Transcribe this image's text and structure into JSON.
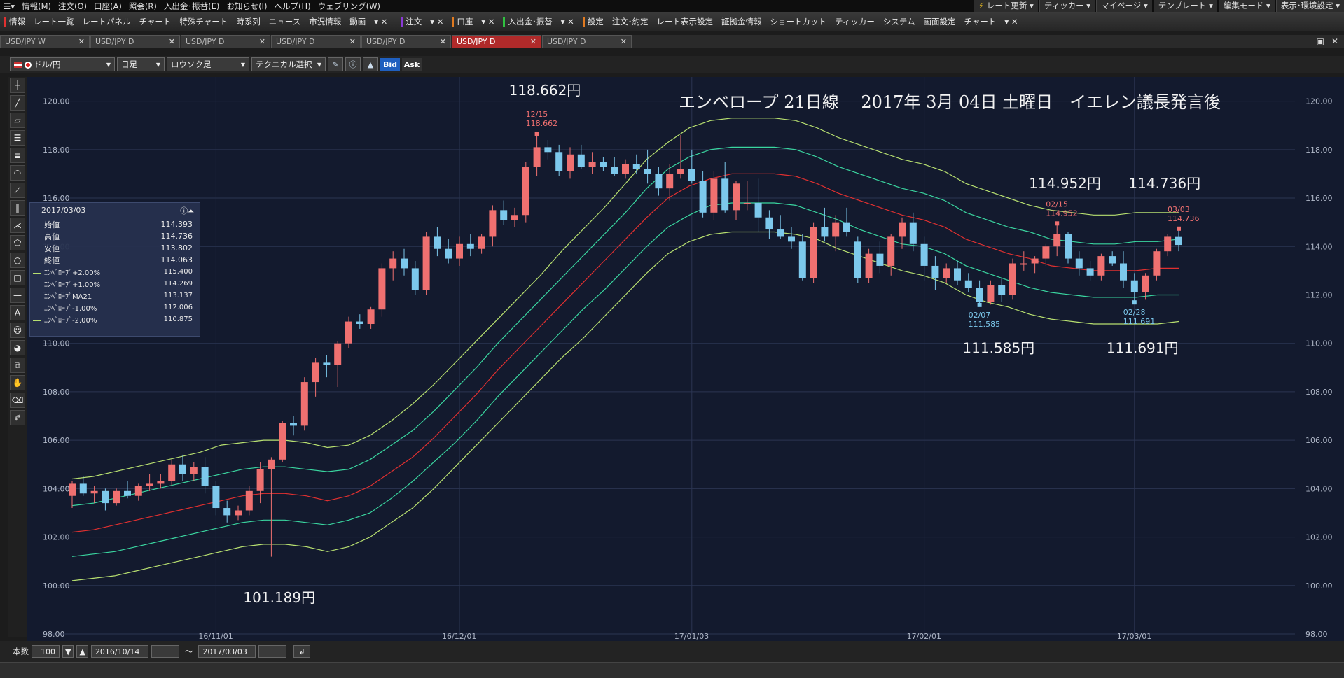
{
  "menubar": {
    "items": [
      "情報(M)",
      "注文(O)",
      "口座(A)",
      "照会(R)",
      "入出金･振替(E)",
      "お知らせ(I)",
      "ヘルプ(H)",
      "ウェブリング(W)"
    ],
    "right_buttons": [
      "レート更新",
      "ティッカー",
      "マイページ",
      "テンプレート",
      "編集モード",
      "表示･環境設定"
    ]
  },
  "toolbar": {
    "items": [
      "情報",
      "レート一覧",
      "レートパネル",
      "チャート",
      "特殊チャート",
      "時系列",
      "ニュース",
      "市況情報",
      "動画"
    ],
    "buttons": [
      "注文",
      "口座",
      "入出金･振替",
      "設定"
    ],
    "items2": [
      "注文･約定",
      "レート表示設定",
      "証拠金情報",
      "ショートカット",
      "ティッカー",
      "システム",
      "画面設定",
      "チャート"
    ],
    "accent_colors": [
      "#e03030",
      "#8a3ad6",
      "#e07a20",
      "#30c040",
      "#e07a20"
    ]
  },
  "tabs": [
    "USD/JPY W",
    "USD/JPY D",
    "USD/JPY D",
    "USD/JPY D",
    "USD/JPY D",
    "USD/JPY D",
    "USD/JPY D"
  ],
  "active_tab": 5,
  "controls": {
    "pair": "ドル/円",
    "timeframe": "日足",
    "chart_type": "ロウソク足",
    "technical": "テクニカル選択",
    "bid": "Bid",
    "ask": "Ask"
  },
  "infobox": {
    "date": "2017/03/03",
    "rows": [
      {
        "label": "始値",
        "value": "114.393"
      },
      {
        "label": "高値",
        "value": "114.736"
      },
      {
        "label": "安値",
        "value": "113.802"
      },
      {
        "label": "終値",
        "value": "114.063"
      }
    ],
    "indicators": [
      {
        "label": "ｴﾝﾍﾞﾛｰﾌﾟ+2.00%",
        "value": "115.400",
        "color": "#b8e070"
      },
      {
        "label": "ｴﾝﾍﾞﾛｰﾌﾟ+1.00%",
        "value": "114.269",
        "color": "#3ad6a0"
      },
      {
        "label": "ｴﾝﾍﾞﾛｰﾌﾟMA21",
        "value": "113.137",
        "color": "#e03030"
      },
      {
        "label": "ｴﾝﾍﾞﾛｰﾌﾟ-1.00%",
        "value": "112.006",
        "color": "#3ad6a0"
      },
      {
        "label": "ｴﾝﾍﾞﾛｰﾌﾟ-2.00%",
        "value": "110.875",
        "color": "#b8e070"
      }
    ]
  },
  "footer": {
    "count_label": "本数",
    "count": "100",
    "from": "2016/10/14",
    "tilde": "～",
    "to": "2017/03/03"
  },
  "chart_data": {
    "type": "candlestick",
    "title": "エンベロープ 21日線　 2017年 3月 04日 土曜日　イエレン議長発言後",
    "ylim": [
      98,
      121
    ],
    "yticks": [
      "98.00",
      "100.00",
      "102.00",
      "104.00",
      "106.00",
      "108.00",
      "110.00",
      "112.00",
      "114.00",
      "116.00",
      "118.00",
      "120.00"
    ],
    "xticks": [
      {
        "label": "16/11/01",
        "index": 13
      },
      {
        "label": "16/12/01",
        "index": 35
      },
      {
        "label": "17/01/03",
        "index": 56
      },
      {
        "label": "17/02/01",
        "index": 77
      },
      {
        "label": "17/03/01",
        "index": 96
      }
    ],
    "candles": [
      [
        103.7,
        104.3,
        103.2,
        104.2
      ],
      [
        104.2,
        104.5,
        103.7,
        103.8
      ],
      [
        103.8,
        104.1,
        103.4,
        103.9
      ],
      [
        103.9,
        104.0,
        103.1,
        103.4
      ],
      [
        103.4,
        104.0,
        103.3,
        103.9
      ],
      [
        103.9,
        104.3,
        103.6,
        103.7
      ],
      [
        103.7,
        104.2,
        103.5,
        104.1
      ],
      [
        104.1,
        104.6,
        103.9,
        104.2
      ],
      [
        104.2,
        104.6,
        104.0,
        104.3
      ],
      [
        104.3,
        105.2,
        104.1,
        105.0
      ],
      [
        105.0,
        105.4,
        104.3,
        104.6
      ],
      [
        104.6,
        105.1,
        104.3,
        104.9
      ],
      [
        104.9,
        105.3,
        103.8,
        104.1
      ],
      [
        104.1,
        104.3,
        102.9,
        103.2
      ],
      [
        103.2,
        103.5,
        102.6,
        102.9
      ],
      [
        102.9,
        103.3,
        102.7,
        103.1
      ],
      [
        103.1,
        104.1,
        102.9,
        103.9
      ],
      [
        103.9,
        105.1,
        103.4,
        104.8
      ],
      [
        104.8,
        105.3,
        101.19,
        105.2
      ],
      [
        105.2,
        106.8,
        105.1,
        106.7
      ],
      [
        106.7,
        107.0,
        106.2,
        106.6
      ],
      [
        106.6,
        108.6,
        106.4,
        108.4
      ],
      [
        108.4,
        109.4,
        107.8,
        109.2
      ],
      [
        109.2,
        109.5,
        108.6,
        109.1
      ],
      [
        109.1,
        110.1,
        108.2,
        110.0
      ],
      [
        110.0,
        111.1,
        109.8,
        110.9
      ],
      [
        110.9,
        111.2,
        110.6,
        110.8
      ],
      [
        110.8,
        111.5,
        110.6,
        111.4
      ],
      [
        111.4,
        113.3,
        111.1,
        113.1
      ],
      [
        113.1,
        113.8,
        112.6,
        113.5
      ],
      [
        113.5,
        113.9,
        112.8,
        113.1
      ],
      [
        113.1,
        113.4,
        112.0,
        112.2
      ],
      [
        112.2,
        114.6,
        112.0,
        114.4
      ],
      [
        114.4,
        114.8,
        113.6,
        113.9
      ],
      [
        113.9,
        114.3,
        113.3,
        113.5
      ],
      [
        113.5,
        114.4,
        113.2,
        114.1
      ],
      [
        114.1,
        114.5,
        113.6,
        113.9
      ],
      [
        113.9,
        114.5,
        113.7,
        114.4
      ],
      [
        114.4,
        115.7,
        114.0,
        115.5
      ],
      [
        115.5,
        115.9,
        114.9,
        115.1
      ],
      [
        115.1,
        115.6,
        114.8,
        115.3
      ],
      [
        115.3,
        117.5,
        115.0,
        117.3
      ],
      [
        117.3,
        118.66,
        116.9,
        118.1
      ],
      [
        118.1,
        118.4,
        117.6,
        117.9
      ],
      [
        117.9,
        118.2,
        116.9,
        117.1
      ],
      [
        117.1,
        118.1,
        116.8,
        117.8
      ],
      [
        117.8,
        118.2,
        117.2,
        117.3
      ],
      [
        117.3,
        117.9,
        117.0,
        117.5
      ],
      [
        117.5,
        117.7,
        117.1,
        117.3
      ],
      [
        117.3,
        117.7,
        116.9,
        117.0
      ],
      [
        117.0,
        117.6,
        116.8,
        117.4
      ],
      [
        117.4,
        117.8,
        117.0,
        117.2
      ],
      [
        117.2,
        118.0,
        116.6,
        117.0
      ],
      [
        117.0,
        117.3,
        116.1,
        116.4
      ],
      [
        116.4,
        117.4,
        115.9,
        117.0
      ],
      [
        117.0,
        118.6,
        116.8,
        117.2
      ],
      [
        117.2,
        118.0,
        116.6,
        116.7
      ],
      [
        116.7,
        117.1,
        115.2,
        115.4
      ],
      [
        115.4,
        117.1,
        115.1,
        116.8
      ],
      [
        116.8,
        117.5,
        115.4,
        115.5
      ],
      [
        115.5,
        116.7,
        115.1,
        116.6
      ],
      [
        115.8,
        116.7,
        115.5,
        115.8
      ],
      [
        115.8,
        116.8,
        114.6,
        115.2
      ],
      [
        115.2,
        115.5,
        114.3,
        114.7
      ],
      [
        114.7,
        115.3,
        114.3,
        114.4
      ],
      [
        114.4,
        114.8,
        113.9,
        114.2
      ],
      [
        114.2,
        114.5,
        112.6,
        112.7
      ],
      [
        112.7,
        115.0,
        112.5,
        114.8
      ],
      [
        114.8,
        115.6,
        114.2,
        114.4
      ],
      [
        114.4,
        115.3,
        113.8,
        115.0
      ],
      [
        115.0,
        115.6,
        114.4,
        114.6
      ],
      [
        114.2,
        114.4,
        112.5,
        112.7
      ],
      [
        112.7,
        113.9,
        112.5,
        113.7
      ],
      [
        113.7,
        114.2,
        112.9,
        113.2
      ],
      [
        113.2,
        114.5,
        112.8,
        114.4
      ],
      [
        114.4,
        115.2,
        113.9,
        115.0
      ],
      [
        115.0,
        115.4,
        113.8,
        114.1
      ],
      [
        114.1,
        114.4,
        112.6,
        113.2
      ],
      [
        113.2,
        113.6,
        112.2,
        112.7
      ],
      [
        112.7,
        113.3,
        112.5,
        113.1
      ],
      [
        113.1,
        113.4,
        112.4,
        112.6
      ],
      [
        112.6,
        112.9,
        112.1,
        112.3
      ],
      [
        112.3,
        112.6,
        111.585,
        111.7
      ],
      [
        111.7,
        112.6,
        111.6,
        112.4
      ],
      [
        112.4,
        112.7,
        111.7,
        112.0
      ],
      [
        112.0,
        113.5,
        111.8,
        113.3
      ],
      [
        113.3,
        113.8,
        113.0,
        113.3
      ],
      [
        113.3,
        113.6,
        112.9,
        113.5
      ],
      [
        113.5,
        114.1,
        113.2,
        114.0
      ],
      [
        114.0,
        114.952,
        113.6,
        114.5
      ],
      [
        114.5,
        114.6,
        113.3,
        113.5
      ],
      [
        113.5,
        113.8,
        112.8,
        113.1
      ],
      [
        113.1,
        113.4,
        112.6,
        112.8
      ],
      [
        112.8,
        113.7,
        112.6,
        113.6
      ],
      [
        113.6,
        113.8,
        113.2,
        113.3
      ],
      [
        113.3,
        113.8,
        112.3,
        112.6
      ],
      [
        112.6,
        112.9,
        111.691,
        112.1
      ],
      [
        112.1,
        112.9,
        111.8,
        112.8
      ],
      [
        112.8,
        113.9,
        112.6,
        113.8
      ],
      [
        113.8,
        114.5,
        113.6,
        114.4
      ],
      [
        114.393,
        114.736,
        113.802,
        114.063
      ]
    ],
    "envelope": {
      "plus2": [
        104.4,
        104.5,
        104.7,
        104.9,
        105.1,
        105.3,
        105.5,
        105.8,
        105.9,
        106.0,
        106.0,
        105.9,
        105.7,
        105.8,
        106.2,
        106.8,
        107.5,
        108.3,
        109.2,
        110.1,
        111.0,
        111.9,
        112.8,
        113.8,
        114.7,
        115.6,
        116.6,
        117.6,
        118.3,
        118.9,
        119.2,
        119.3,
        119.3,
        119.3,
        119.2,
        118.9,
        118.5,
        118.2,
        117.9,
        117.6,
        117.4,
        117.1,
        116.6,
        116.3,
        116.0,
        115.7,
        115.5,
        115.4,
        115.3,
        115.3,
        115.4,
        115.4,
        115.4
      ],
      "plus1": [
        103.3,
        103.4,
        103.6,
        103.8,
        104.0,
        104.2,
        104.4,
        104.6,
        104.8,
        104.9,
        104.9,
        104.8,
        104.7,
        104.8,
        105.2,
        105.8,
        106.4,
        107.2,
        108.1,
        109.0,
        110.0,
        110.9,
        111.8,
        112.7,
        113.6,
        114.5,
        115.4,
        116.4,
        117.2,
        117.7,
        118.0,
        118.1,
        118.1,
        118.1,
        118.0,
        117.7,
        117.3,
        117.0,
        116.7,
        116.4,
        116.2,
        115.9,
        115.4,
        115.1,
        114.8,
        114.6,
        114.3,
        114.2,
        114.1,
        114.1,
        114.2,
        114.2,
        114.3
      ],
      "ma": [
        102.2,
        102.3,
        102.5,
        102.7,
        102.9,
        103.1,
        103.3,
        103.5,
        103.7,
        103.8,
        103.8,
        103.7,
        103.5,
        103.7,
        104.1,
        104.7,
        105.3,
        106.1,
        107.0,
        107.9,
        108.9,
        109.8,
        110.7,
        111.6,
        112.5,
        113.4,
        114.3,
        115.2,
        116.0,
        116.5,
        116.8,
        117.0,
        117.0,
        117.0,
        116.9,
        116.6,
        116.2,
        115.9,
        115.6,
        115.3,
        115.1,
        114.8,
        114.3,
        114.0,
        113.7,
        113.5,
        113.2,
        113.1,
        113.0,
        113.0,
        113.0,
        113.1,
        113.1
      ],
      "minus1": [
        101.2,
        101.3,
        101.4,
        101.6,
        101.8,
        102.0,
        102.2,
        102.4,
        102.6,
        102.7,
        102.7,
        102.6,
        102.5,
        102.7,
        103.0,
        103.6,
        104.3,
        105.1,
        105.9,
        106.8,
        107.8,
        108.7,
        109.6,
        110.5,
        111.4,
        112.2,
        113.1,
        114.0,
        114.8,
        115.3,
        115.7,
        115.8,
        115.8,
        115.8,
        115.7,
        115.4,
        115.1,
        114.7,
        114.4,
        114.1,
        114.0,
        113.7,
        113.2,
        112.9,
        112.6,
        112.3,
        112.1,
        112.0,
        111.9,
        111.9,
        111.9,
        112.0,
        112.0
      ],
      "minus2": [
        100.2,
        100.3,
        100.4,
        100.6,
        100.8,
        101.0,
        101.2,
        101.4,
        101.6,
        101.7,
        101.7,
        101.6,
        101.4,
        101.6,
        102.0,
        102.6,
        103.2,
        104.0,
        104.9,
        105.8,
        106.7,
        107.6,
        108.5,
        109.4,
        110.2,
        111.1,
        112.0,
        112.9,
        113.7,
        114.2,
        114.5,
        114.6,
        114.6,
        114.6,
        114.5,
        114.3,
        113.9,
        113.6,
        113.3,
        113.0,
        112.8,
        112.5,
        112.0,
        111.7,
        111.5,
        111.2,
        111.0,
        110.9,
        110.8,
        110.8,
        110.8,
        110.8,
        110.9
      ]
    },
    "point_labels": [
      {
        "index": 42,
        "date": "12/15",
        "value": "118.662",
        "pos": "top"
      },
      {
        "index": 89,
        "date": "02/15",
        "value": "114.952",
        "pos": "top"
      },
      {
        "index": 100,
        "date": "03/03",
        "value": "114.736",
        "pos": "top"
      },
      {
        "index": 82,
        "date": "02/07",
        "value": "111.585",
        "pos": "bottom"
      },
      {
        "index": 96,
        "date": "02/28",
        "value": "111.691",
        "pos": "bottom"
      }
    ],
    "annotations": [
      {
        "text": "118.662円",
        "index": 42,
        "value": 120.25
      },
      {
        "text": "101.189円",
        "index": 18,
        "value": 99.3
      },
      {
        "text": "114.952円",
        "index": 89,
        "value": 116.4
      },
      {
        "text": "114.736円",
        "index": 98,
        "value": 116.4
      },
      {
        "text": "111.585円",
        "index": 83,
        "value": 109.6
      },
      {
        "text": "111.691円",
        "index": 96,
        "value": 109.6
      }
    ],
    "colors": {
      "up": "#ef7070",
      "down": "#7cc8ec",
      "plus2": "#b8e070",
      "plus1": "#3ad6a0",
      "ma": "#e03030",
      "minus1": "#3ad6a0",
      "minus2": "#b8e070",
      "grid": "#2b3552",
      "axis_text": "#b0b8c8",
      "bg": "#131a2e"
    }
  }
}
